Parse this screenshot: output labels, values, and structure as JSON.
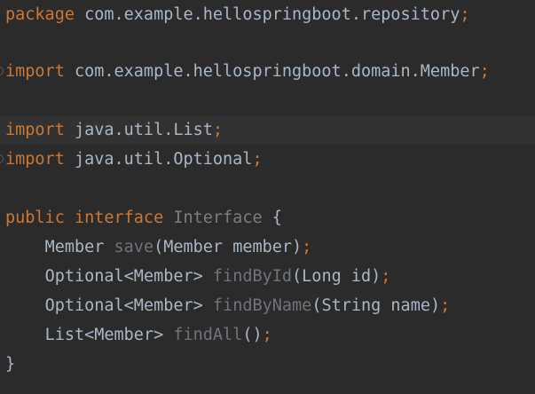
{
  "editor": {
    "lines": [
      {
        "kw": "package",
        "rest": " com.example.hellospringboot.repository",
        "semi": ";"
      },
      {
        "kw": "import",
        "rest": " com.example.hellospringboot.domain.Member",
        "semi": ";"
      },
      {
        "kw": "import",
        "rest": " java.util.List",
        "semi": ";"
      },
      {
        "kw": "import",
        "rest": " java.util.Optional",
        "semi": ";"
      },
      {
        "kw1": "public",
        "kw2": "interface",
        "name": "Interface",
        "brace": "{"
      },
      {
        "ret": "Member",
        "method": "save",
        "params": "(Member member)",
        "semi": ";"
      },
      {
        "ret": "Optional<Member>",
        "method": "findById",
        "params": "(Long id)",
        "semi": ";"
      },
      {
        "ret": "Optional<Member>",
        "method": "findByName",
        "params": "(String name)",
        "semi": ";"
      },
      {
        "ret": "List<Member>",
        "method": "findAll",
        "params": "()",
        "semi": ";"
      },
      {
        "brace": "}"
      }
    ]
  },
  "colors": {
    "background": "#2b2b2b",
    "current_line": "#323232",
    "keyword": "#cc7832",
    "text": "#a9b7c6",
    "interface_name": "#7d7d7d",
    "method_name": "#6f737a"
  }
}
